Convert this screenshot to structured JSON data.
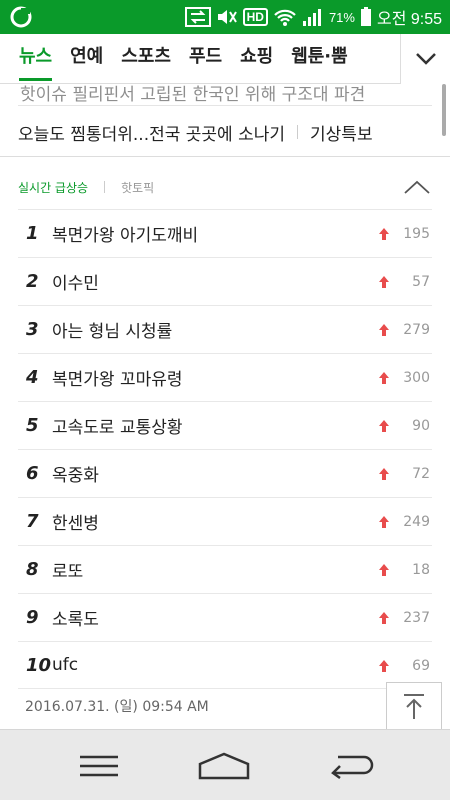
{
  "statusbar": {
    "battery_percent": "71%",
    "time": "오전 9:55",
    "icons": [
      "app-logo-icon",
      "data-transfer-icon",
      "volume-muted-icon",
      "hd-voice-icon",
      "wifi-icon",
      "signal-icon",
      "battery-icon"
    ],
    "hd_label": "HD"
  },
  "tabs": [
    {
      "label": "뉴스",
      "active": true
    },
    {
      "label": "연예",
      "active": false
    },
    {
      "label": "스포츠",
      "active": false
    },
    {
      "label": "푸드",
      "active": false
    },
    {
      "label": "쇼핑",
      "active": false
    },
    {
      "label": "웹툰·뿜",
      "active": false
    }
  ],
  "content": {
    "clipped_headline": "핫이슈  필리핀서 고립된 한국인 위해 구조대 파견",
    "headline": "오늘도 찜통더위...전국 곳곳에 소나기",
    "headline_tag": "기상특보"
  },
  "ranking": {
    "tab_active": "실시간 급상승",
    "tab_other": "핫토픽",
    "items": [
      {
        "rank": "1",
        "keyword": "복면가왕 아기도깨비",
        "count": "195"
      },
      {
        "rank": "2",
        "keyword": "이수민",
        "count": "57"
      },
      {
        "rank": "3",
        "keyword": "아는 형님 시청률",
        "count": "279"
      },
      {
        "rank": "4",
        "keyword": "복면가왕 꼬마유령",
        "count": "300"
      },
      {
        "rank": "5",
        "keyword": "고속도로 교통상황",
        "count": "90"
      },
      {
        "rank": "6",
        "keyword": "옥중화",
        "count": "72"
      },
      {
        "rank": "7",
        "keyword": "한센병",
        "count": "249"
      },
      {
        "rank": "8",
        "keyword": "로또",
        "count": "18"
      },
      {
        "rank": "9",
        "keyword": "소록도",
        "count": "237"
      },
      {
        "rank": "10",
        "keyword": "ufc",
        "count": "69"
      }
    ],
    "timestamp": "2016.07.31. (일) 09:54 AM"
  },
  "colors": {
    "brand_green": "#0a9a2a",
    "up_arrow": "#e84c4c"
  }
}
